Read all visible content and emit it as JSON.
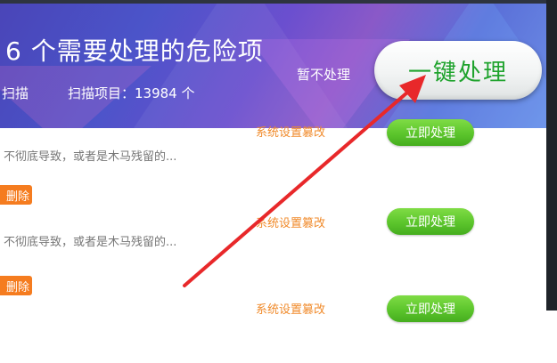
{
  "header": {
    "title": "6 个需要处理的危险项",
    "scan_left": "扫描",
    "scan_items": "扫描项目：13984 个",
    "skip_label": "暂不处理",
    "one_click_label": "一键处理"
  },
  "rows": [
    {
      "desc": "不彻底导致，或者是木马残留的...",
      "category": "系统设置篡改",
      "delete_label": "删除",
      "fix_label": "立即处理"
    },
    {
      "desc": "不彻底导致，或者是木马残留的...",
      "category": "系统设置篡改",
      "delete_label": "删除",
      "fix_label": "立即处理"
    },
    {
      "desc": "",
      "category": "系统设置篡改",
      "delete_label": "",
      "fix_label": "立即处理"
    }
  ],
  "colors": {
    "accent_green": "#5cc52c",
    "warning_orange": "#f08a2a",
    "arrow_red": "#e8282a"
  }
}
